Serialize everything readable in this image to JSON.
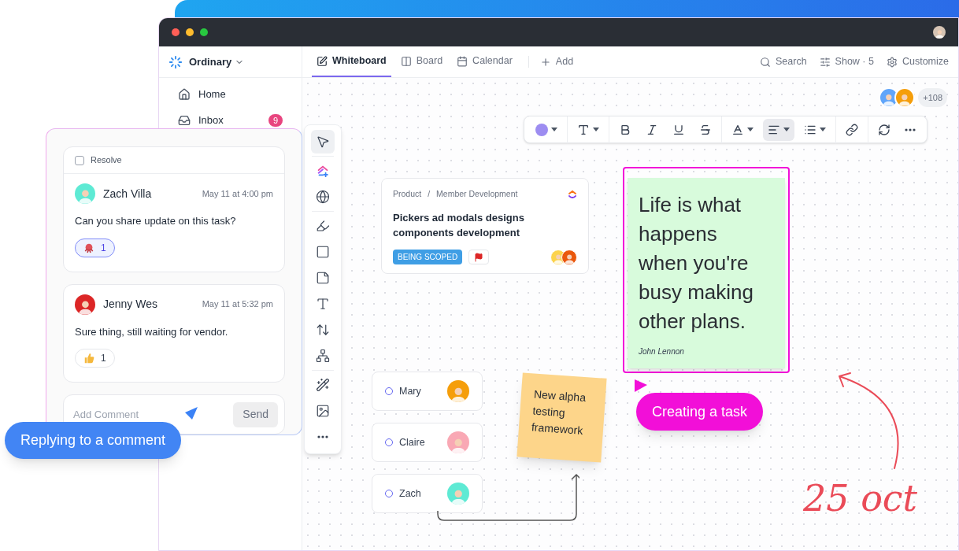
{
  "workspace": {
    "name": "Ordinary"
  },
  "sidebar": {
    "items": [
      {
        "label": "Home",
        "kind": "home",
        "selected": false
      },
      {
        "label": "Inbox",
        "kind": "inbox",
        "selected": false,
        "badge": "9"
      }
    ]
  },
  "tabs": [
    {
      "label": "Whiteboard",
      "kind": "whiteboard",
      "selected": true
    },
    {
      "label": "Board",
      "kind": "board",
      "selected": false
    },
    {
      "label": "Calendar",
      "kind": "calendar",
      "selected": false
    }
  ],
  "add_view": "Add",
  "header_actions": [
    {
      "label": "Search",
      "kind": "search"
    },
    {
      "label": "Show · 5",
      "kind": "show"
    },
    {
      "label": "Customize",
      "kind": "customize"
    }
  ],
  "collaborators": {
    "avatars": [
      {
        "color": "#60a5fa"
      },
      {
        "color": "#f59e0b"
      }
    ],
    "more": "+108"
  },
  "format_toolbar": [
    {
      "kind": "color",
      "selected": false
    },
    {
      "kind": "text-style",
      "selected": false
    },
    {
      "kind": "bold",
      "selected": false
    },
    {
      "kind": "italic",
      "selected": false
    },
    {
      "kind": "underline",
      "selected": false
    },
    {
      "kind": "strike",
      "selected": false
    },
    {
      "kind": "font-color",
      "selected": false
    },
    {
      "kind": "align",
      "selected": true
    },
    {
      "kind": "list",
      "selected": false
    },
    {
      "kind": "link",
      "selected": false
    },
    {
      "kind": "convert",
      "selected": false
    },
    {
      "kind": "more",
      "selected": false
    }
  ],
  "tools": [
    {
      "kind": "select",
      "selected": true
    },
    {
      "kind": "ai",
      "selected": false
    },
    {
      "kind": "globe",
      "selected": false
    },
    {
      "kind": "pen",
      "selected": false
    },
    {
      "kind": "shape",
      "selected": false
    },
    {
      "kind": "sticky",
      "selected": false
    },
    {
      "kind": "text",
      "selected": false
    },
    {
      "kind": "connector",
      "selected": false
    },
    {
      "kind": "mindmap",
      "selected": false
    },
    {
      "kind": "magic",
      "selected": false
    },
    {
      "kind": "image",
      "selected": false
    },
    {
      "kind": "more",
      "selected": false
    }
  ],
  "task_card": {
    "breadcrumb": [
      "Product",
      "Member Development"
    ],
    "breadcrumb_separator": "/",
    "title": "Pickers ad modals designs components development",
    "status": "BEING SCOPED",
    "assignees": [
      {
        "color": "#fcd34d"
      },
      {
        "color": "#ea580c"
      }
    ]
  },
  "quote_sticky": {
    "text": "Life is what happens when you're busy making other plans.",
    "author": "John Lennon"
  },
  "people": [
    {
      "name": "Mary",
      "color": "#f59e0b"
    },
    {
      "name": "Claire",
      "color": "#f9a8b4"
    },
    {
      "name": "Zach",
      "color": "#5eead4"
    }
  ],
  "yellow_sticky": {
    "text": "New alpha testing framework"
  },
  "annotation": "25 oct",
  "comments_panel": {
    "resolve": {
      "label": "Resolve",
      "checked": false
    },
    "comments": [
      {
        "author": "Zach Villa",
        "time": "May 11 at 4:00 pm",
        "text": "Can you share update on this task?",
        "color": "#5eead4",
        "reaction": {
          "kind": "octopus",
          "count": "1",
          "selected": true
        }
      },
      {
        "author": "Jenny Wes",
        "time": "May 11 at 5:32 pm",
        "text": "Sure thing, still waiting for vendor.",
        "color": "#dc2626",
        "reaction": {
          "kind": "thumbs-up",
          "count": "1",
          "selected": false
        }
      }
    ],
    "input": {
      "placeholder": "Add Comment"
    },
    "send": "Send"
  },
  "callouts": [
    {
      "text": "Replying to a comment",
      "kind": "blue"
    },
    {
      "text": "Creating a task",
      "kind": "magenta"
    }
  ]
}
